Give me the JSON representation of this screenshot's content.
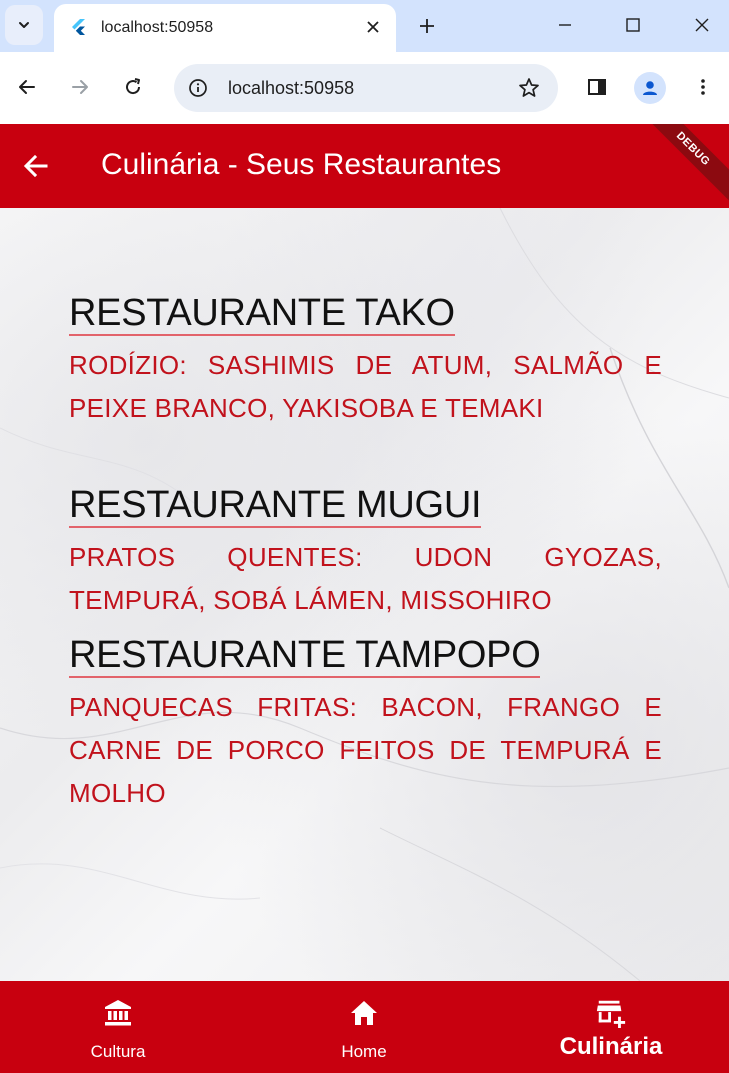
{
  "browser": {
    "tab_title": "localhost:50958",
    "url": "localhost:50958"
  },
  "colors": {
    "primary": "#c8000f",
    "title_text": "#111111",
    "description_text": "#c1121c",
    "underline": "#e2636b"
  },
  "appbar": {
    "title": "Culinária - Seus Restaurantes",
    "debug_label": "DEBUG"
  },
  "restaurants": [
    {
      "name": "RESTAURANTE TAKO",
      "description": "RODÍZIO: SASHIMIS DE ATUM, SALMÃO E PEIXE BRANCO, YAKISOBA E TEMAKI"
    },
    {
      "name": "RESTAURANTE MUGUI",
      "description": "PRATOS QUENTES: UDON GYOZAS, TEMPURÁ, SOBÁ LÁMEN, MISSOHIRO"
    },
    {
      "name": "RESTAURANTE TAMPOPO",
      "description": "PANQUECAS FRITAS: BACON, FRANGO E CARNE DE PORCO FEITOS DE TEMPURÁ E MOLHO"
    }
  ],
  "bottom_nav": {
    "items": [
      {
        "label": "Cultura",
        "icon": "museum-icon",
        "selected": false
      },
      {
        "label": "Home",
        "icon": "home-icon",
        "selected": false
      },
      {
        "label": "Culinária",
        "icon": "add-business-icon",
        "selected": true
      }
    ]
  }
}
